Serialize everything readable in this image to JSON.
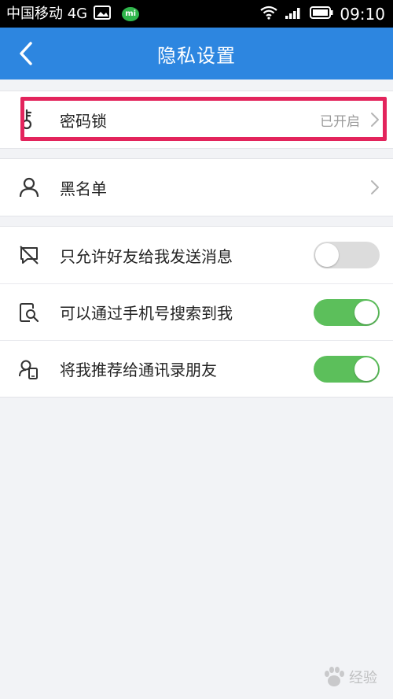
{
  "status_bar": {
    "carrier": "中国移动 4G",
    "image_icon": "image-icon",
    "message_badge": "mi",
    "wifi_icon": "wifi-icon",
    "signal_icon": "signal-icon",
    "battery_icon": "battery-icon",
    "time": "09:10"
  },
  "nav": {
    "back_icon": "chevron-left-icon",
    "title": "隐私设置"
  },
  "password_lock": {
    "icon": "key-icon",
    "label": "密码锁",
    "value": "已开启",
    "chevron_icon": "chevron-right-icon"
  },
  "blacklist": {
    "icon": "person-icon",
    "label": "黑名单",
    "chevron_icon": "chevron-right-icon"
  },
  "toggles": [
    {
      "icon": "message-blocked-icon",
      "label": "只允许好友给我发送消息",
      "on": false
    },
    {
      "icon": "phone-search-icon",
      "label": "可以通过手机号搜索到我",
      "on": true
    },
    {
      "icon": "contacts-recommend-icon",
      "label": "将我推荐给通讯录朋友",
      "on": true
    }
  ],
  "colors": {
    "nav_blue": "#2d86e0",
    "toggle_on": "#5cbf5b",
    "toggle_off": "#dcdcdc",
    "highlight": "#e3245c"
  },
  "watermark": {
    "text": "经验"
  }
}
